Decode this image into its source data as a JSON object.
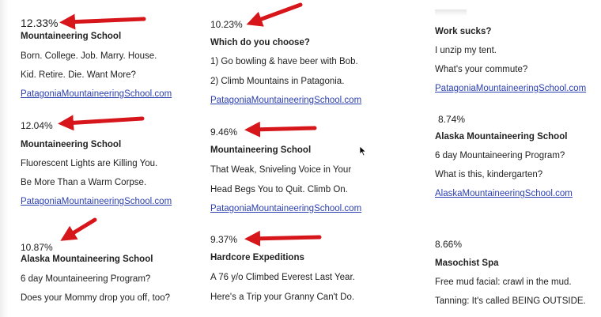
{
  "ads": [
    {
      "pct": "12.33%",
      "headline": "Mountaineering School",
      "line1": "Born. College. Job. Marry. House.",
      "line2": "Kid. Retire. Die.  Want More?",
      "url": "PatagoniaMountaineeringSchool.com"
    },
    {
      "pct": "12.04%",
      "headline": "Mountaineering School",
      "line1": "Fluorescent Lights are Killing You.",
      "line2": "Be More Than a Warm Corpse.",
      "url": "PatagoniaMountaineeringSchool.com"
    },
    {
      "pct": "10.87%",
      "headline": "Alaska Mountaineering School",
      "line1": "6 day Mountaineering Program?",
      "line2": "Does your Mommy drop you off, too?",
      "url": ""
    },
    {
      "pct": "10.23%",
      "headline": "Which do you choose?",
      "line1": "1) Go bowling & have beer with Bob.",
      "line2": "2) Climb Mountains in Patagonia.",
      "url": "PatagoniaMountaineeringSchool.com"
    },
    {
      "pct": "9.46%",
      "headline": "Mountaineering School",
      "line1": "That Weak, Sniveling Voice in Your",
      "line2": "Head Begs You to Quit.  Climb On.",
      "url": "PatagoniaMountaineeringSchool.com"
    },
    {
      "pct": "9.37%",
      "headline": "Hardcore Expeditions",
      "line1": "A 76 y/o Climbed Everest Last Year.",
      "line2": "Here's a Trip your Granny Can't Do.",
      "url": ""
    },
    {
      "pct": "",
      "headline": "Work sucks?",
      "line1": "I unzip my tent.",
      "line2": "What's your commute?",
      "url": "PatagoniaMountaineeringSchool.com"
    },
    {
      "pct": "8.74%",
      "headline": "Alaska Mountaineering School",
      "line1": "6 day Mountaineering Program?",
      "line2": "What is this, kindergarten?",
      "url": "AlaskaMountaineeringSchool.com"
    },
    {
      "pct": "8.66%",
      "headline": "Masochist Spa",
      "line1": "Free mud facial: crawl in the mud.",
      "line2": "Tanning: It's called BEING OUTSIDE.",
      "url": ""
    }
  ],
  "colors": {
    "arrow": "#d7161b",
    "link": "#2b3fb0",
    "text": "#222222"
  },
  "icons": [
    "red-arrow-icon",
    "mouse-cursor-icon"
  ]
}
